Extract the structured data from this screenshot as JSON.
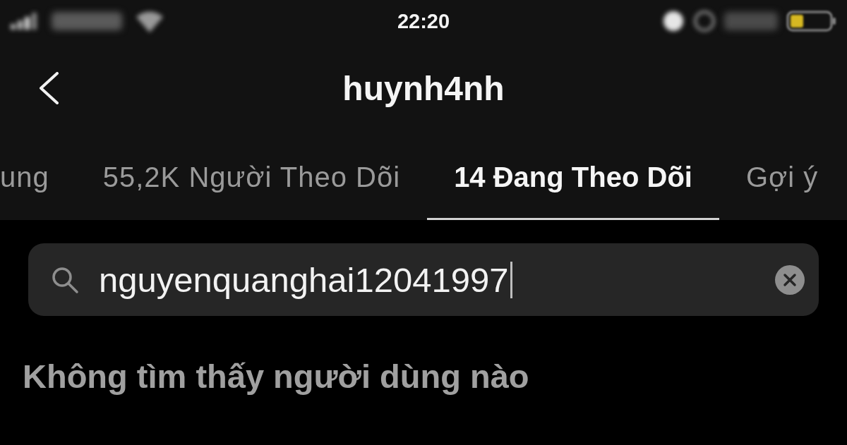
{
  "status_bar": {
    "time": "22:20"
  },
  "header": {
    "title": "huynh4nh"
  },
  "tabs": [
    {
      "label": "ung",
      "selected": false
    },
    {
      "label": "55,2K Người Theo Dõi",
      "selected": false
    },
    {
      "label": "14 Đang Theo Dõi",
      "selected": true
    },
    {
      "label": "Gợi ý",
      "selected": false
    }
  ],
  "search": {
    "value": "nguyenquanghai12041997",
    "focused": true
  },
  "empty_message": "Không tìm thấy người dùng nào"
}
